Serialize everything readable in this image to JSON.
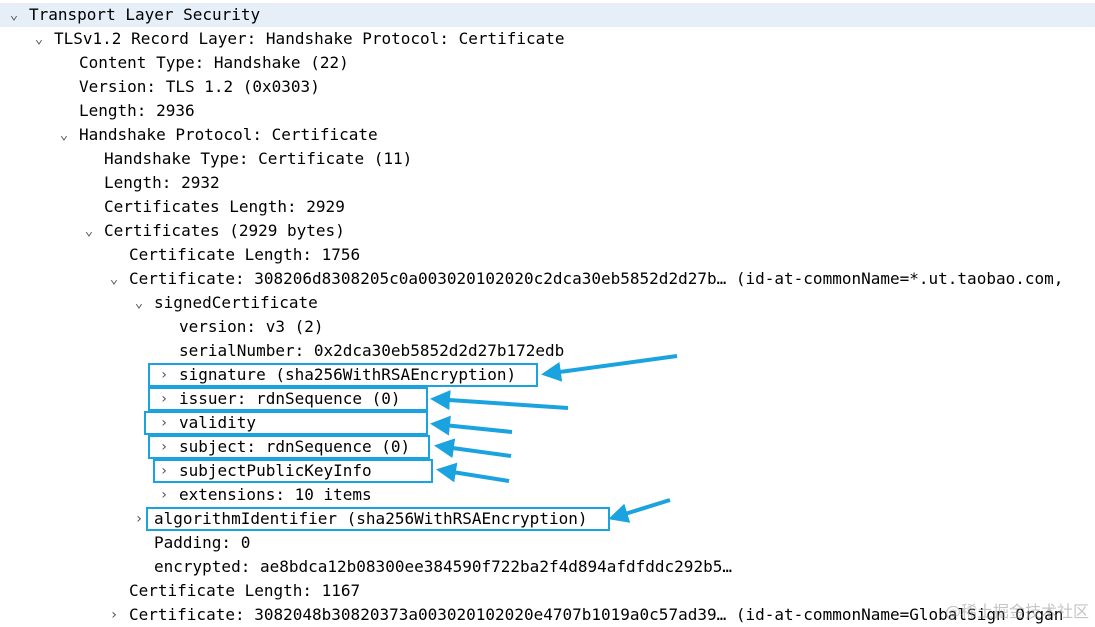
{
  "tree": [
    {
      "depth": 0,
      "toggle": "expanded",
      "text": "Transport Layer Security",
      "selected": true
    },
    {
      "depth": 1,
      "toggle": "expanded",
      "text": "TLSv1.2 Record Layer: Handshake Protocol: Certificate"
    },
    {
      "depth": 2,
      "toggle": "none",
      "text": "Content Type: Handshake (22)"
    },
    {
      "depth": 2,
      "toggle": "none",
      "text": "Version: TLS 1.2 (0x0303)"
    },
    {
      "depth": 2,
      "toggle": "none",
      "text": "Length: 2936"
    },
    {
      "depth": 2,
      "toggle": "expanded",
      "text": "Handshake Protocol: Certificate"
    },
    {
      "depth": 3,
      "toggle": "none",
      "text": "Handshake Type: Certificate (11)"
    },
    {
      "depth": 3,
      "toggle": "none",
      "text": "Length: 2932"
    },
    {
      "depth": 3,
      "toggle": "none",
      "text": "Certificates Length: 2929"
    },
    {
      "depth": 3,
      "toggle": "expanded",
      "text": "Certificates (2929 bytes)"
    },
    {
      "depth": 4,
      "toggle": "none",
      "text": "Certificate Length: 1756"
    },
    {
      "depth": 4,
      "toggle": "expanded",
      "text": "Certificate: 308206d8308205c0a003020102020c2dca30eb5852d2d27b… (id-at-commonName=*.ut.taobao.com,"
    },
    {
      "depth": 5,
      "toggle": "expanded",
      "text": "signedCertificate"
    },
    {
      "depth": 6,
      "toggle": "none",
      "text": "version: v3 (2)"
    },
    {
      "depth": 6,
      "toggle": "none",
      "text": "serialNumber: 0x2dca30eb5852d2d27b172edb"
    },
    {
      "depth": 6,
      "toggle": "collapsed",
      "text": "signature (sha256WithRSAEncryption)",
      "highlight": true
    },
    {
      "depth": 6,
      "toggle": "collapsed",
      "text": "issuer: rdnSequence (0)",
      "highlight": true
    },
    {
      "depth": 6,
      "toggle": "collapsed",
      "text": "validity",
      "highlight": true
    },
    {
      "depth": 6,
      "toggle": "collapsed",
      "text": "subject: rdnSequence (0)",
      "highlight": true
    },
    {
      "depth": 6,
      "toggle": "collapsed",
      "text": "subjectPublicKeyInfo",
      "highlight": true
    },
    {
      "depth": 6,
      "toggle": "collapsed",
      "text": "extensions: 10 items"
    },
    {
      "depth": 5,
      "toggle": "collapsed",
      "text": "algorithmIdentifier (sha256WithRSAEncryption)",
      "highlight": true
    },
    {
      "depth": 5,
      "toggle": "none",
      "text": "Padding: 0"
    },
    {
      "depth": 5,
      "toggle": "none",
      "text": "encrypted: ae8bdca12b08300ee384590f722ba2f4d894afdfddc292b5…"
    },
    {
      "depth": 4,
      "toggle": "none",
      "text": "Certificate Length: 1167"
    },
    {
      "depth": 4,
      "toggle": "collapsed",
      "text": "Certificate: 3082048b30820373a003020102020e4707b1019a0c57ad39… (id-at-commonName=GlobalSign Organ"
    }
  ],
  "toggle_glyphs": {
    "expanded": "⌄",
    "collapsed": "›",
    "none": ""
  },
  "watermark": "@稀土掘金技术社区",
  "colors": {
    "accent": "#1aa3df",
    "selected_row": "#e6eef7"
  }
}
